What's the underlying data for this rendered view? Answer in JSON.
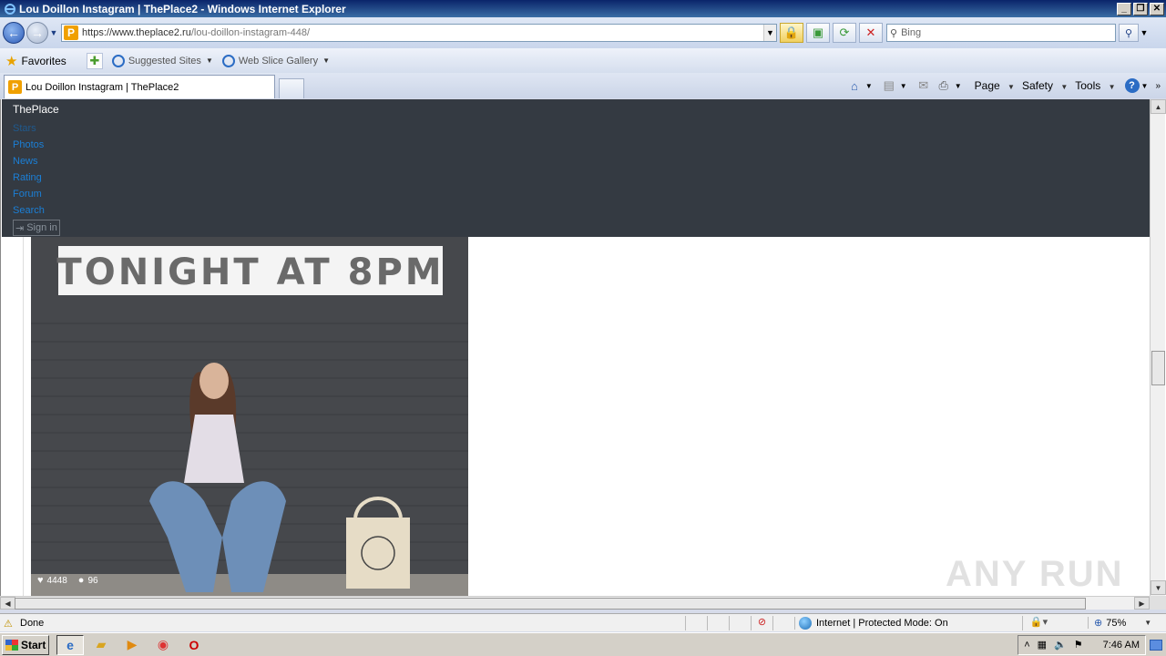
{
  "window": {
    "title": "Lou Doillon Instagram | ThePlace2 - Windows Internet Explorer"
  },
  "address": {
    "url_host": "https://www.theplace2.ru",
    "url_path": "/lou-doillon-instagram-448/",
    "search_placeholder": "Bing"
  },
  "favorites": {
    "label": "Favorites",
    "links": [
      {
        "label": "Suggested Sites"
      },
      {
        "label": "Web Slice Gallery"
      }
    ]
  },
  "tab": {
    "title": "Lou Doillon Instagram | ThePlace2"
  },
  "command_bar": {
    "page": "Page",
    "safety": "Safety",
    "tools": "Tools"
  },
  "site": {
    "brand": "ThePlace",
    "menu": [
      {
        "label": "Stars"
      },
      {
        "label": "Photos"
      },
      {
        "label": "News"
      },
      {
        "label": "Rating"
      },
      {
        "label": "Forum"
      },
      {
        "label": "Search"
      }
    ],
    "signin": "Sign in",
    "photo": {
      "banner_text": "TONIGHT AT 8PM",
      "likes": "4448",
      "comments": "96"
    }
  },
  "status": {
    "text": "Done",
    "zone": "Internet | Protected Mode: On",
    "zoom": "75%"
  },
  "taskbar": {
    "start": "Start",
    "clock": "7:46 AM"
  },
  "watermark": "ANY RUN",
  "colors": {
    "site_header_bg": "#343a42",
    "menu_link": "#1b7fd6"
  }
}
